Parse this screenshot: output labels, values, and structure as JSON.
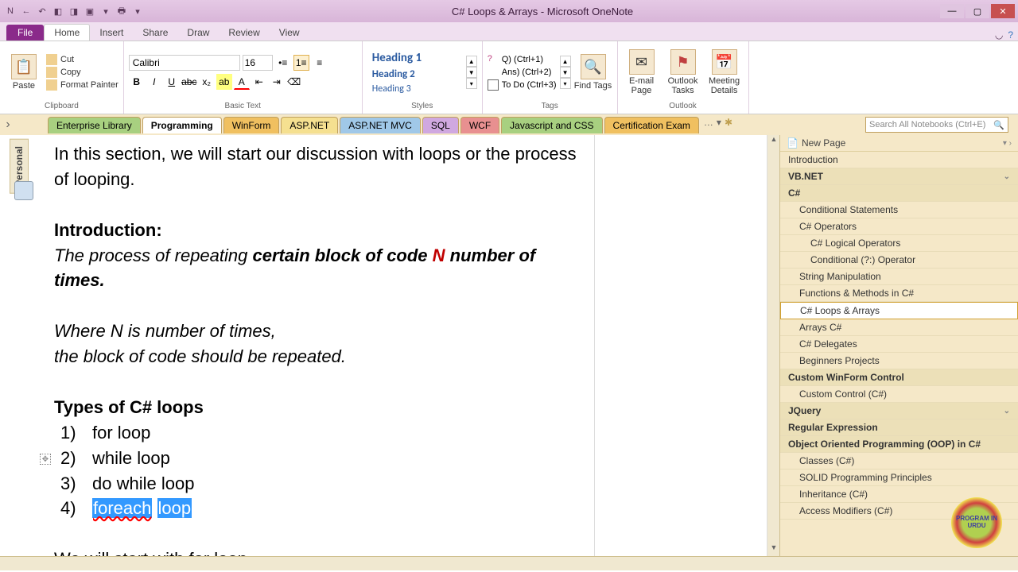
{
  "title": "C# Loops & Arrays - Microsoft OneNote",
  "ribbon_tabs": {
    "file": "File",
    "home": "Home",
    "insert": "Insert",
    "share": "Share",
    "draw": "Draw",
    "review": "Review",
    "view": "View"
  },
  "clipboard": {
    "paste": "Paste",
    "cut": "Cut",
    "copy": "Copy",
    "format_painter": "Format Painter",
    "group": "Clipboard"
  },
  "basic_text": {
    "font": "Calibri",
    "size": "16",
    "group": "Basic Text"
  },
  "styles": {
    "h1": "Heading 1",
    "h2": "Heading 2",
    "h3": "Heading 3",
    "group": "Styles"
  },
  "tags": {
    "q": "Q) (Ctrl+1)",
    "ans": "Ans) (Ctrl+2)",
    "todo": "To Do (Ctrl+3)",
    "find": "Find Tags",
    "group": "Tags"
  },
  "outlook": {
    "email": "E-mail Page",
    "tasks": "Outlook Tasks",
    "meeting": "Meeting Details",
    "group": "Outlook"
  },
  "notebook_vtab": "Personal",
  "sections": {
    "items": [
      "Enterprise Library",
      "Programming",
      "WinForm",
      "ASP.NET",
      "ASP.NET MVC",
      "SQL",
      "WCF",
      "Javascript and CSS",
      "Certification Exam"
    ],
    "more": "…"
  },
  "search_placeholder": "Search All Notebooks (Ctrl+E)",
  "content": {
    "intro1": "In this section, we will start our discussion with loops or the process of looping.",
    "heading_intro": "Introduction",
    "def_prefix": "The process of repeating ",
    "def_bold": "certain block of code ",
    "def_n": "N",
    "def_suffix": " number of times",
    "where": "Where N is number of times,",
    "block": "the block of code should be repeated.",
    "types": "Types of C# loops",
    "l1n": "1)",
    "l1": "for loop",
    "l2n": "2)",
    "l2": "while loop",
    "l3n": "3)",
    "l3": "do while loop",
    "l4n": "4)",
    "l4a": "foreach",
    "l4b": "loop",
    "closing": "We will start with for loop."
  },
  "pages": {
    "new": "New Page",
    "intro": "Introduction",
    "vbnet": "VB.NET",
    "csharp": "C#",
    "cond": "Conditional Statements",
    "ops": "C# Operators",
    "logops": "C# Logical Operators",
    "condop": "Conditional (?:) Operator",
    "strman": "String Manipulation",
    "funcs": "Functions & Methods in C#",
    "loops": "C# Loops & Arrays",
    "arrays": "Arrays C#",
    "delegates": "C# Delegates",
    "beginners": "Beginners Projects",
    "winform": "Custom WinForm Control",
    "customctrl": "Custom Control (C#)",
    "jquery": "JQuery",
    "regex": "Regular Expression",
    "oop": "Object Oriented Programming (OOP) in C#",
    "classes": "Classes (C#)",
    "solid": "SOLID Programming Principles",
    "inherit": "Inheritance (C#)",
    "access": "Access Modifiers (C#)"
  },
  "badge": "PROGRAM IN URDU"
}
